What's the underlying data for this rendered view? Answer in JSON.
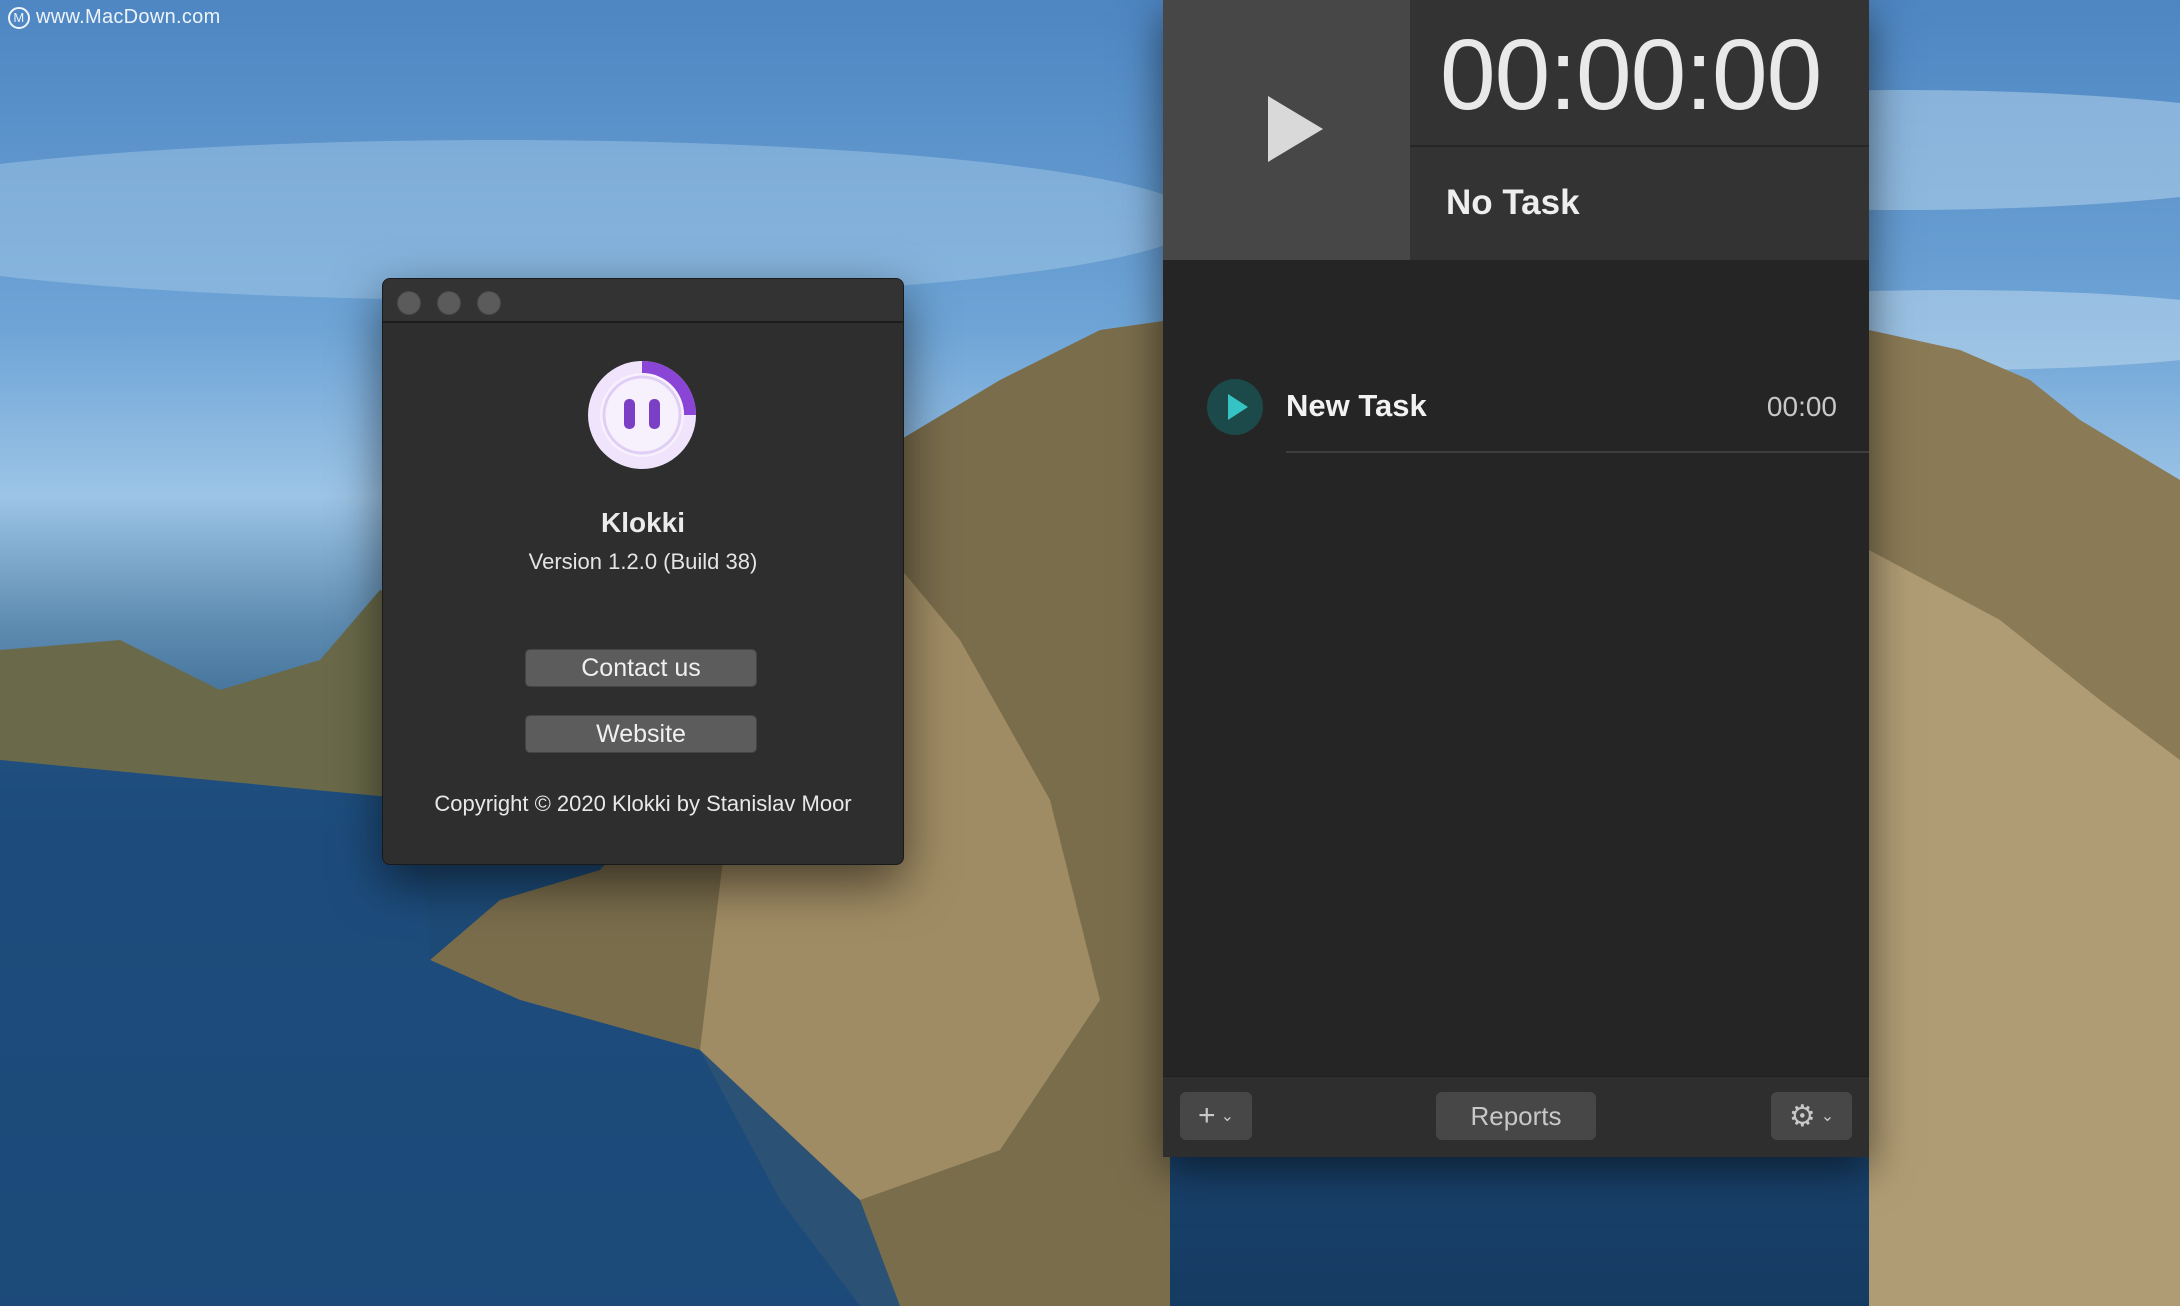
{
  "watermark": {
    "text": "www.MacDown.com",
    "icon": "m-circle-icon"
  },
  "about_window": {
    "app_name": "Klokki",
    "version": "Version 1.2.0 (Build 38)",
    "contact_label": "Contact us",
    "website_label": "Website",
    "copyright": "Copyright © 2020 Klokki by Stanislav Moor",
    "accent_color": "#8b45d6"
  },
  "main_panel": {
    "timer": "00:00:00",
    "current_task": "No Task",
    "tasks": [
      {
        "name": "New Task",
        "time": "00:00"
      }
    ],
    "footer": {
      "add_icon": "+",
      "chevron_icon": "⌄",
      "reports_label": "Reports",
      "settings_icon": "⚙"
    },
    "accent_color": "#35c3c3"
  }
}
